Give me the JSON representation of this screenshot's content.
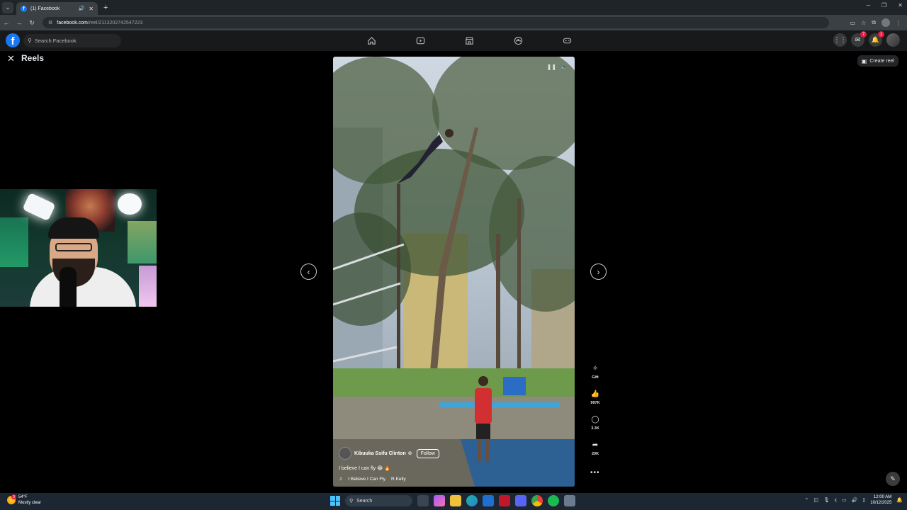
{
  "browser": {
    "tab_title": "(1) Facebook",
    "url_host": "facebook.com",
    "url_path": "/reel/2113202742547223"
  },
  "fb_header": {
    "search_placeholder": "Search Facebook",
    "messenger_badge": "7",
    "notifications_badge": "1"
  },
  "reels": {
    "title": "Reels",
    "create_reel_label": "Create reel"
  },
  "reel": {
    "author": "Kibuuka Ssifu Clinton",
    "follow_label": "Follow",
    "caption": "I believe I can fly 😂 🔥",
    "audio_title": "I Believe I Can Fly",
    "audio_artist": "R.Kelly"
  },
  "rail": {
    "gift_label": "Gift",
    "likes": "997K",
    "comments": "3.3K",
    "shares": "20K"
  },
  "taskbar": {
    "weather_temp": "54°F",
    "weather_desc": "Mostly clear",
    "weather_badge": "3",
    "search_label": "Search",
    "time": "12:00 AM",
    "date": "10/12/2025"
  },
  "colors": {
    "fb_blue": "#1877f2",
    "dark_bg": "#000000",
    "header_bg": "#18191a"
  }
}
